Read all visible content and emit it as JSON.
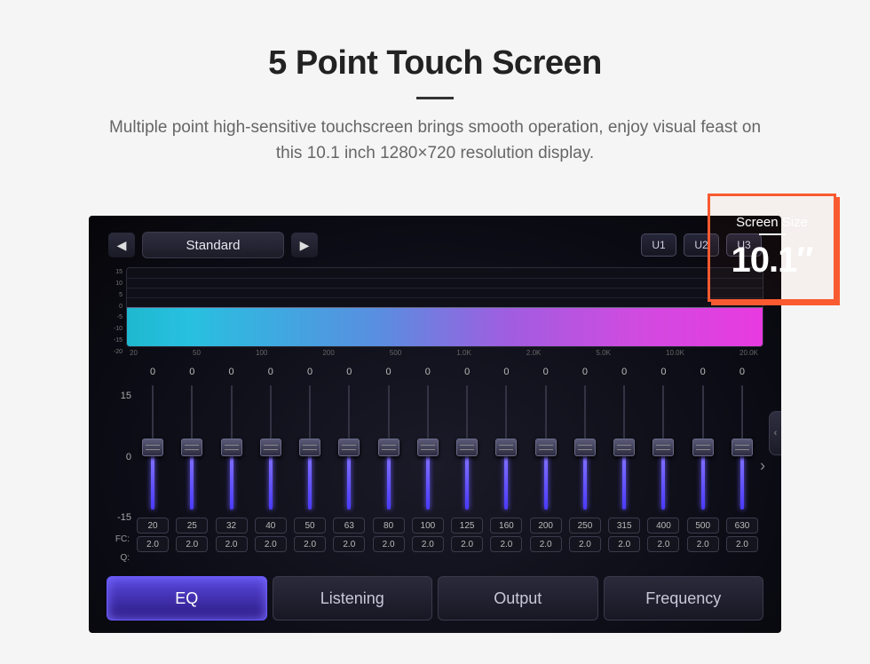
{
  "title": "5 Point Touch Screen",
  "description_line1": "Multiple point high-sensitive touchscreen brings smooth operation, enjoy visual feast on",
  "description_line2": "this 10.1 inch 1280×720 resolution display.",
  "callout": {
    "label": "Screen Size",
    "value": "10.1″"
  },
  "eq_ui": {
    "preset": "Standard",
    "user_presets": [
      "U1",
      "U2",
      "U3"
    ],
    "spectrum": {
      "y_ticks": [
        "15",
        "10",
        "5",
        "0",
        "-5",
        "-10",
        "-15",
        "-20"
      ],
      "x_ticks": [
        "20",
        "50",
        "100",
        "200",
        "500",
        "1.0K",
        "2.0K",
        "5.0K",
        "10.0K",
        "20.0K"
      ]
    },
    "slider_y_axis": [
      "15",
      "0",
      "-15"
    ],
    "fc_label": "FC:",
    "q_label": "Q:",
    "bands": [
      {
        "gain": "0",
        "fc": "20",
        "q": "2.0"
      },
      {
        "gain": "0",
        "fc": "25",
        "q": "2.0"
      },
      {
        "gain": "0",
        "fc": "32",
        "q": "2.0"
      },
      {
        "gain": "0",
        "fc": "40",
        "q": "2.0"
      },
      {
        "gain": "0",
        "fc": "50",
        "q": "2.0"
      },
      {
        "gain": "0",
        "fc": "63",
        "q": "2.0"
      },
      {
        "gain": "0",
        "fc": "80",
        "q": "2.0"
      },
      {
        "gain": "0",
        "fc": "100",
        "q": "2.0"
      },
      {
        "gain": "0",
        "fc": "125",
        "q": "2.0"
      },
      {
        "gain": "0",
        "fc": "160",
        "q": "2.0"
      },
      {
        "gain": "0",
        "fc": "200",
        "q": "2.0"
      },
      {
        "gain": "0",
        "fc": "250",
        "q": "2.0"
      },
      {
        "gain": "0",
        "fc": "315",
        "q": "2.0"
      },
      {
        "gain": "0",
        "fc": "400",
        "q": "2.0"
      },
      {
        "gain": "0",
        "fc": "500",
        "q": "2.0"
      },
      {
        "gain": "0",
        "fc": "630",
        "q": "2.0"
      }
    ],
    "tabs": [
      {
        "label": "EQ",
        "active": true
      },
      {
        "label": "Listening",
        "active": false
      },
      {
        "label": "Output",
        "active": false
      },
      {
        "label": "Frequency",
        "active": false
      }
    ]
  }
}
